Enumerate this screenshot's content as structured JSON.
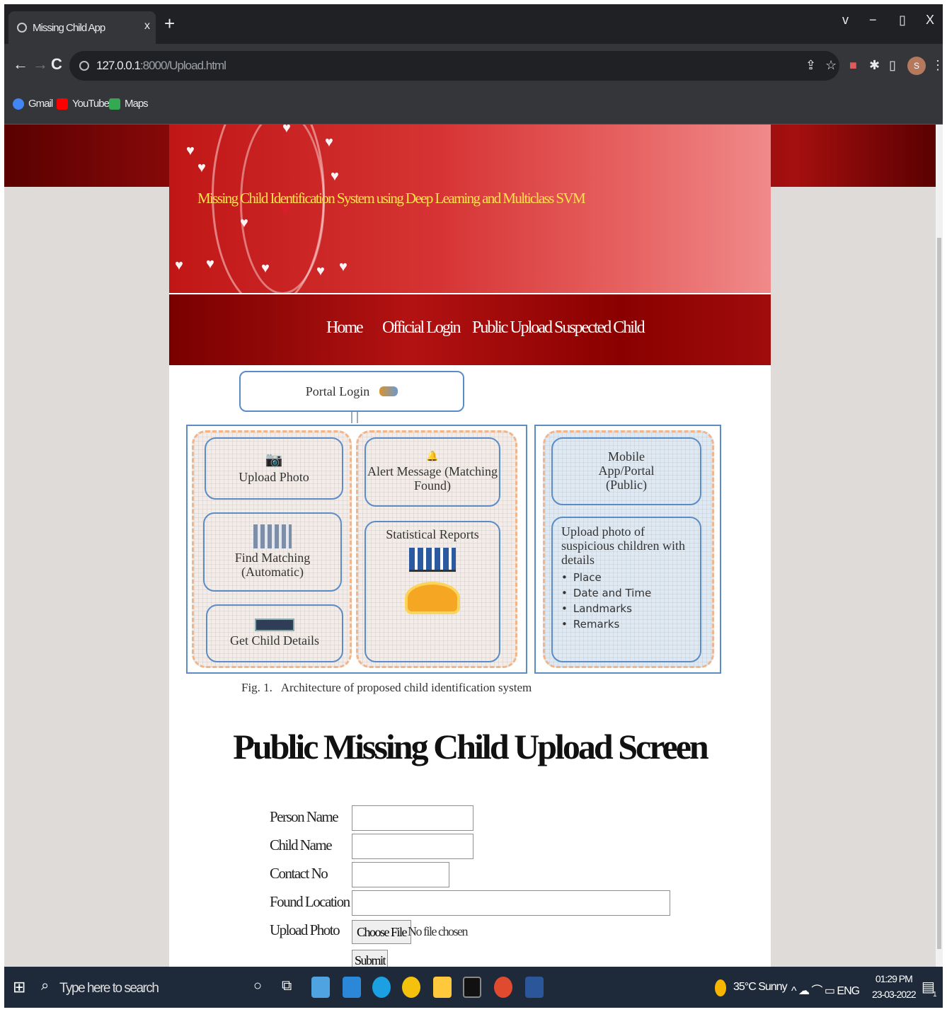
{
  "browser": {
    "tab_title": "Missing Child App",
    "tab_close": "x",
    "new_tab": "+",
    "window_controls": [
      "v",
      "−",
      "▯",
      "X"
    ],
    "nav": {
      "back": "←",
      "forward": "→",
      "reload": "C"
    },
    "url_host": "127.0.0.1",
    "url_path": ":8000/Upload.html",
    "toolbar_icons": [
      "share-icon",
      "star-icon",
      "extension-icon",
      "puzzle-icon",
      "sidepanel-icon",
      "profile-icon",
      "menu-icon"
    ],
    "avatar_letter": "S",
    "bookmarks": [
      {
        "label": "Gmail",
        "icon": "gmail-icon",
        "color": "#4285f4"
      },
      {
        "label": "YouTube",
        "icon": "youtube-icon",
        "color": "#ff0000"
      },
      {
        "label": "Maps",
        "icon": "maps-icon",
        "color": "#34a853"
      }
    ]
  },
  "site": {
    "title": "Missing Child Identification System using Deep Learning and Multiclass SVM",
    "nav": [
      "Home",
      "Official Login",
      "Public Upload Suspected Child"
    ]
  },
  "figure": {
    "portal_login": "Portal Login",
    "left_boxes": [
      "Upload Photo",
      "Find Matching (Automatic)",
      "Get Child Details"
    ],
    "mid_boxes": [
      "Alert Message (Matching Found)",
      "Statistical Reports"
    ],
    "mobile_box": "Mobile App/Portal (Public)",
    "upload_box_title": "Upload photo of suspicious children with details",
    "upload_box_items": [
      "Place",
      "Date and Time",
      "Landmarks",
      "Remarks"
    ],
    "caption": "Fig. 1.   Architecture of proposed child identification system"
  },
  "page_heading": "Public Missing Child Upload Screen",
  "form": {
    "person_name_label": "Person Name",
    "person_name_value": "",
    "child_name_label": "Child Name",
    "child_name_value": "",
    "contact_label": "Contact No",
    "contact_value": "",
    "location_label": "Found Location",
    "location_value": "",
    "photo_label": "Upload Photo",
    "choose_file": "Choose File",
    "file_status": "No file chosen",
    "submit": "Submit"
  },
  "taskbar": {
    "search_placeholder": "Type here to search",
    "weather": "35°C  Sunny",
    "tray_icons": "^ ☁ ⌒ ▭ ENG",
    "time": "01:29 PM",
    "date": "23-03-2022",
    "notification_count": "1"
  },
  "colors": {
    "header_red": "#c01616",
    "nav_dark_red": "#8a0000",
    "title_yellow": "#ffe24a",
    "figure_blue": "#5b8cc6",
    "dash_orange": "#f2b58a"
  }
}
